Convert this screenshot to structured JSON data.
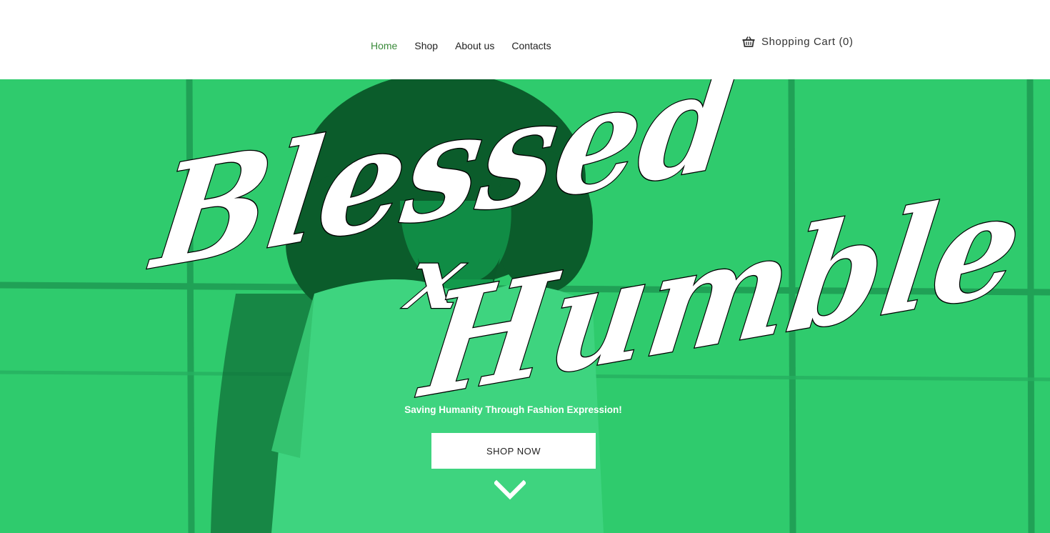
{
  "nav": {
    "items": [
      {
        "label": "Home",
        "active": true
      },
      {
        "label": "Shop",
        "active": false
      },
      {
        "label": "About us",
        "active": false
      },
      {
        "label": "Contacts",
        "active": false
      }
    ]
  },
  "cart": {
    "label": "Shopping Cart (0)",
    "icon": "basket-icon"
  },
  "hero": {
    "brand_line1": "Blessed",
    "brand_x": "x",
    "brand_line2": "Humble",
    "tagline": "Saving Humanity Through Fashion Expression!",
    "cta_label": "SHOP NOW",
    "scroll_icon": "chevron-down-icon"
  },
  "colors": {
    "accent": "#3a8a3a",
    "hero_green": "#2fcb6d",
    "hero_dark": "#0e6a35"
  }
}
